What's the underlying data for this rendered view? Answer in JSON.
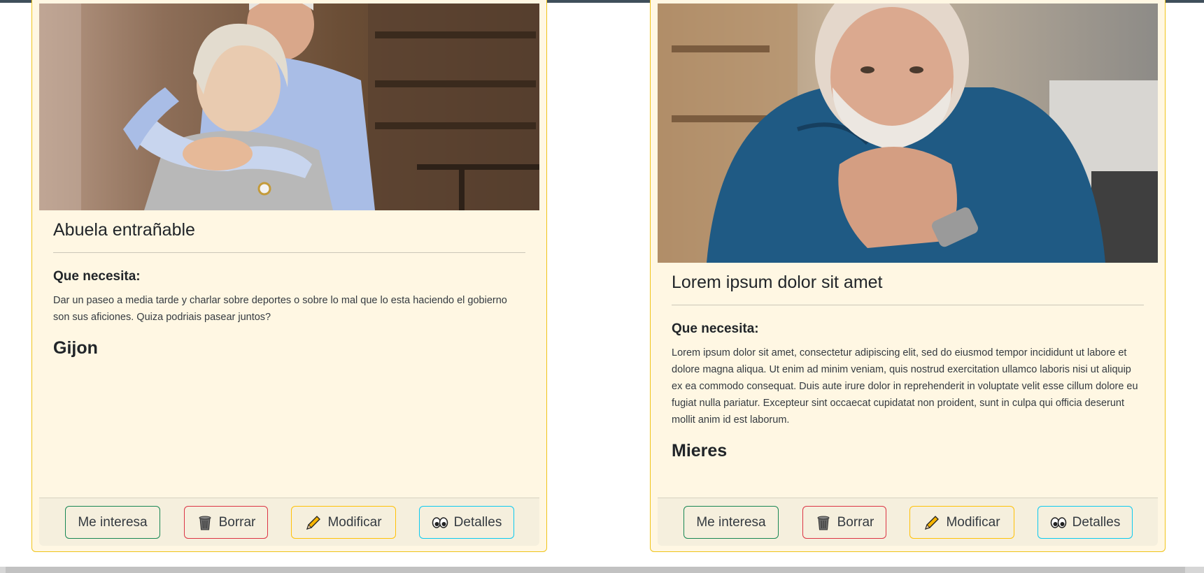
{
  "cards": [
    {
      "title": "Abuela entrañable",
      "need_label": "Que necesita:",
      "need_text": "Dar un paseo a media tarde y charlar sobre deportes o sobre lo mal que lo esta haciendo el gobierno son sus aficiones. Quiza podriais pasear juntos?",
      "city": "Gijon",
      "buttons": {
        "interest": "Me interesa",
        "delete": "Borrar",
        "edit": "Modificar",
        "details": "Detalles"
      }
    },
    {
      "title": "Lorem ipsum dolor sit amet",
      "need_label": "Que necesita:",
      "need_text": "Lorem ipsum dolor sit amet, consectetur adipiscing elit, sed do eiusmod tempor incididunt ut labore et dolore magna aliqua. Ut enim ad minim veniam, quis nostrud exercitation ullamco laboris nisi ut aliquip ex ea commodo consequat. Duis aute irure dolor in reprehenderit in voluptate velit esse cillum dolore eu fugiat nulla pariatur. Excepteur sint occaecat cupidatat non proident, sunt in culpa qui officia deserunt mollit anim id est laborum.",
      "city": "Mieres",
      "buttons": {
        "interest": "Me interesa",
        "delete": "Borrar",
        "edit": "Modificar",
        "details": "Detalles"
      }
    }
  ],
  "icons": {
    "delete": "trash-can-icon",
    "edit": "pencil-icon",
    "details": "eyes-icon"
  },
  "colors": {
    "card_background": "#fff7e3",
    "card_border": "#f0c419",
    "interest_border": "#198754",
    "delete_border": "#dc3545",
    "edit_border": "#ffc107",
    "details_border": "#0dcaf0"
  }
}
